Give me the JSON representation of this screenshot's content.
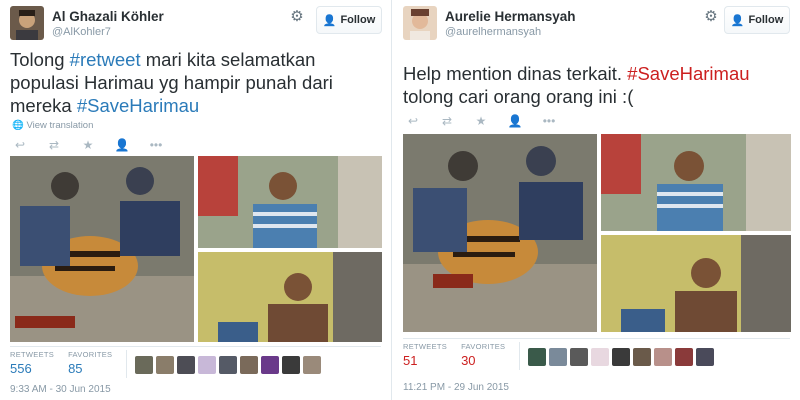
{
  "left_tweet": {
    "name": "Al Ghazali Köhler",
    "handle": "@AlKohler7",
    "follow_label": "Follow",
    "text_parts": [
      "Tolong ",
      "#retweet",
      " mari kita selamatkan",
      "populasi Harimau yg hampir punah dari",
      "mereka ",
      "#SaveHarimau"
    ],
    "view_translation": "View translation",
    "retweets_label": "RETWEETS",
    "retweets": "556",
    "favorites_label": "FAVORITES",
    "favorites": "85",
    "timestamp": "9:33 AM - 30 Jun 2015"
  },
  "right_tweet": {
    "name": "Aurelie Hermansyah",
    "handle": "@aurelhermansyah",
    "follow_label": "Follow",
    "text_parts": [
      "Help mention dinas terkait. ",
      "#SaveHarimau",
      "tolong cari orang orang ini :("
    ],
    "retweets_label": "RETWEETS",
    "retweets": "51",
    "favorites_label": "FAVORITES",
    "favorites": "30",
    "timestamp": "11:21 PM - 29 Jun 2015"
  },
  "icons": {
    "gear": "gear-icon",
    "follow": "add-user-icon",
    "reply": "reply-icon",
    "retweet": "retweet-icon",
    "favorite": "star-icon",
    "follow_action": "user-icon",
    "more": "more-icon"
  },
  "colors": {
    "hashtag_blue": "#2b7bb9",
    "hashtag_red": "#cc1f1f",
    "retweet_count_red": "#cc1f1f",
    "link_blue": "#2b7bb9"
  }
}
